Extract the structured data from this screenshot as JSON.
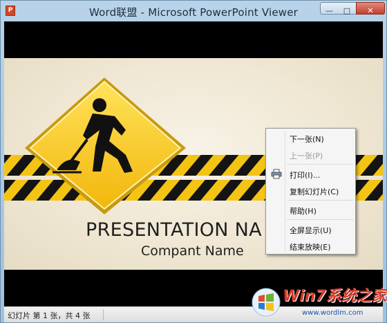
{
  "window": {
    "title": "Word联盟 - Microsoft PowerPoint Viewer",
    "app_icon_letter": "P",
    "buttons": {
      "minimize": "—",
      "maximize": "□",
      "close": "✕"
    }
  },
  "slide": {
    "title": "PRESENTATION  NA",
    "subtitle": "Compant Name",
    "colors": {
      "stripe_yellow": "#f4c414",
      "stripe_black": "#141414",
      "sign_yellow": "#f8c81a",
      "background": "#f2ead8"
    }
  },
  "context_menu": {
    "items": [
      {
        "label": "下一张(N)",
        "enabled": true
      },
      {
        "label": "上一张(P)",
        "enabled": false
      },
      {
        "label": "打印(I)...",
        "enabled": true,
        "icon": "printer-icon"
      },
      {
        "label": "复制幻灯片(C)",
        "enabled": true
      },
      {
        "label": "帮助(H)",
        "enabled": true
      },
      {
        "label": "全屏显示(U)",
        "enabled": true
      },
      {
        "label": "结束放映(E)",
        "enabled": true
      }
    ]
  },
  "statusbar": {
    "text": "幻灯片 第 1 张，共 4 张"
  },
  "watermark": {
    "brand": "Win7系统之家",
    "url": "www.wordlm.com",
    "icon": "windows-logo-icon"
  }
}
